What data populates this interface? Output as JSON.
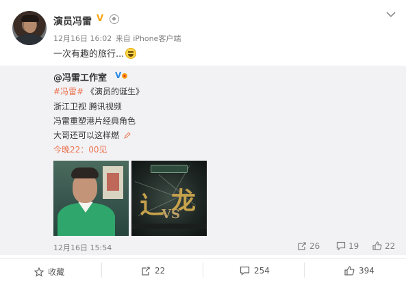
{
  "post": {
    "author": "演员冯雷",
    "time": "12月16日 16:02",
    "source": "来自 iPhone客户端",
    "text": "一次有趣的旅行...",
    "emoji_icon": "laugh-emoji-icon"
  },
  "repost": {
    "author": "@冯雷工作室",
    "topic1": "#冯雷#",
    "topic2": "《演员的诞生》",
    "line2": "浙江卫视 腾讯视频",
    "line3": "冯雷重塑港片经典角色",
    "line4": "大哥还可以这样燃",
    "line5": "今晚22：00见",
    "time": "12月16日 15:54",
    "forward_count": "26",
    "comment_count": "19",
    "like_count": "22"
  },
  "actions": {
    "favorite": "收藏",
    "forward": "22",
    "comment": "254",
    "like": "394"
  },
  "colors": {
    "topic": "#eb7350",
    "verified": "#f7a20f",
    "repost_bg": "#f2f2f5"
  }
}
